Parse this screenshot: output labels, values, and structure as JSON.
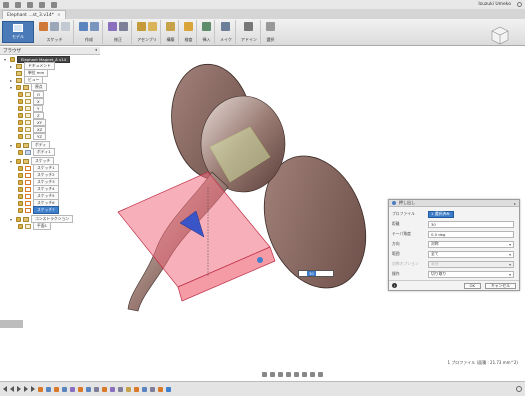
{
  "titlebar": {
    "user_name": "Izuzuki Umeko"
  },
  "tab": {
    "title": "Elephant ...st_3.v14*"
  },
  "toolbar": {
    "workspace_label": "モデル",
    "groups": [
      {
        "label": "スケッチ"
      },
      {
        "label": "作成"
      },
      {
        "label": "修正"
      },
      {
        "label": "アセンブリ"
      },
      {
        "label": "構築"
      },
      {
        "label": "検査"
      },
      {
        "label": "挿入"
      },
      {
        "label": "メイク"
      },
      {
        "label": "アドイン"
      },
      {
        "label": "選択"
      }
    ]
  },
  "browser": {
    "title": "ブラウザ",
    "items": [
      {
        "label": "Elephant Magnet_A v14"
      },
      {
        "label": "ドキュメント"
      },
      {
        "label": "単位 mm"
      },
      {
        "label": "ビュー"
      },
      {
        "label": "原点"
      },
      {
        "label": "O"
      },
      {
        "label": "X"
      },
      {
        "label": "Y"
      },
      {
        "label": "Z"
      },
      {
        "label": "XY"
      },
      {
        "label": "XZ"
      },
      {
        "label": "YZ"
      },
      {
        "label": "ボディ"
      },
      {
        "label": "ボディ1"
      },
      {
        "label": "スケッチ"
      },
      {
        "label": "スケッチ1"
      },
      {
        "label": "スケッチ2"
      },
      {
        "label": "スケッチ3"
      },
      {
        "label": "スケッチ4"
      },
      {
        "label": "スケッチ5"
      },
      {
        "label": "スケッチ6"
      },
      {
        "label": "スケッチ7"
      },
      {
        "label": "コンストラクション"
      },
      {
        "label": "平面1"
      }
    ]
  },
  "dialog": {
    "title": "押し出し",
    "rows": [
      {
        "key": "プロファイル",
        "value": "1 選択済み"
      },
      {
        "key": "距離",
        "value": "30"
      },
      {
        "key": "テーパ角度",
        "value": "0.0 deg"
      },
      {
        "key": "方向",
        "value": "対称"
      },
      {
        "key": "範囲",
        "value": "全て"
      },
      {
        "key": "対称オプション",
        "value": "半分"
      },
      {
        "key": "操作",
        "value": "切り取り"
      }
    ],
    "ok": "OK",
    "cancel": "キャンセル"
  },
  "viewport": {
    "value_input": "30"
  },
  "status": {
    "text": "1 プロファイル (面積 : 21.73 mm^2)"
  },
  "colors": {
    "accent": "#3c7bc8",
    "model": "#7a5a50",
    "extrude": "#f07080"
  }
}
